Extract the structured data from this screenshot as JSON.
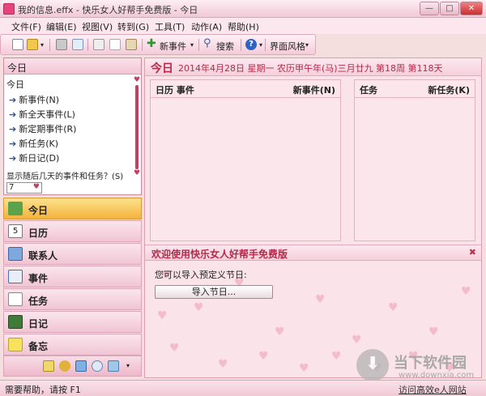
{
  "window": {
    "title": "我的信息.effx - 快乐女人好帮手免费版 - 今日",
    "minimize": "—",
    "maximize": "□",
    "close": "✕"
  },
  "menu": [
    "文件(F)",
    "编辑(E)",
    "视图(V)",
    "转到(G)",
    "工具(T)",
    "动作(A)",
    "帮助(H)"
  ],
  "toolbar": {
    "new_event": "新事件",
    "search": "搜索",
    "skin": "界面风格",
    "dropdown": "▾",
    "help_q": "?"
  },
  "today_pane": {
    "header": "今日",
    "sub": "今日",
    "items": [
      "新事件(N)",
      "新全天事件(L)",
      "新定期事件(R)",
      "新任务(K)",
      "新日记(D)"
    ],
    "question": "显示随后几天的事件和任务？(S)",
    "days_value": "7",
    "heart": "♥"
  },
  "nav": {
    "items": [
      "今日",
      "日历",
      "联系人",
      "事件",
      "任务",
      "日记",
      "备忘"
    ],
    "selected_index": 0,
    "calendar_icon_digit": "5"
  },
  "content": {
    "today_label": "今日",
    "date_line": "2014年4月28日  星期一  农历甲午年(马)三月廿九  第18周  第118天",
    "calendar_section": {
      "left": "日历  事件",
      "right": "新事件(N)"
    },
    "task_section": {
      "left": "任务",
      "right": "新任务(K)"
    },
    "welcome_title": "欢迎使用快乐女人好帮手免费版",
    "welcome_close": "✖",
    "import_hint": "您可以导入预定义节日:",
    "import_button": "导入节日..."
  },
  "watermark": {
    "name": "当下软件园",
    "url": "www.downxia.com"
  },
  "status": {
    "help": "需要帮助，请按 F1",
    "link": "访问高效e人网站"
  },
  "colors": {
    "accent": "#c34160",
    "selected_nav": "#f3b23c",
    "pink_bg": "#fbe3ea"
  }
}
